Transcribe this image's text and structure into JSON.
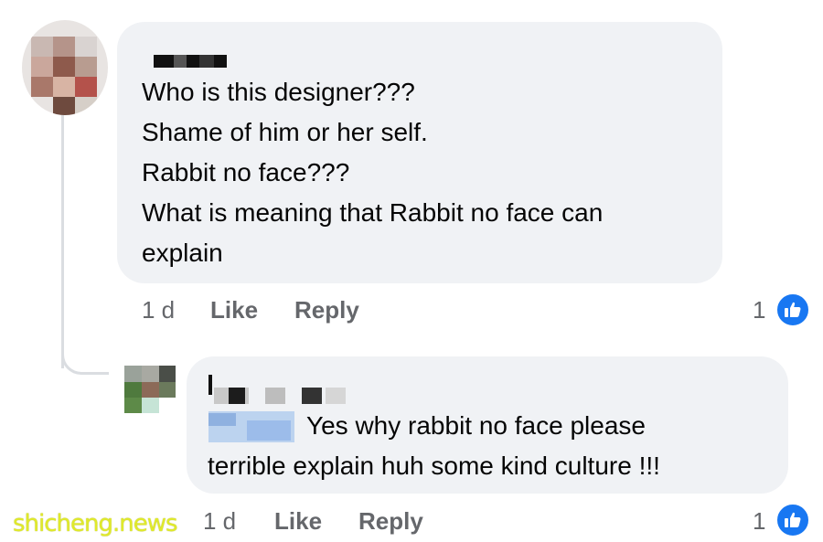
{
  "comment": {
    "lines": [
      "Who is this designer???",
      "Shame of him or her self.",
      "Rabbit no face???",
      "What is meaning that Rabbit no face can",
      "explain"
    ],
    "time": "1 d",
    "like_label": "Like",
    "reply_label": "Reply",
    "reaction_count": "1",
    "reaction_icon": "thumbs-up-icon"
  },
  "reply": {
    "lines": [
      "Yes why rabbit no face  please",
      "terrible explain huh  some kind culture !!!"
    ],
    "time": "1 d",
    "like_label": "Like",
    "reply_label": "Reply",
    "reaction_count": "1",
    "reaction_icon": "thumbs-up-icon"
  },
  "watermark": "shicheng.news",
  "colors": {
    "bubble": "#f0f2f5",
    "meta_text": "#65676b",
    "like_blue": "#1877f2",
    "watermark": "#e0ea2a"
  }
}
